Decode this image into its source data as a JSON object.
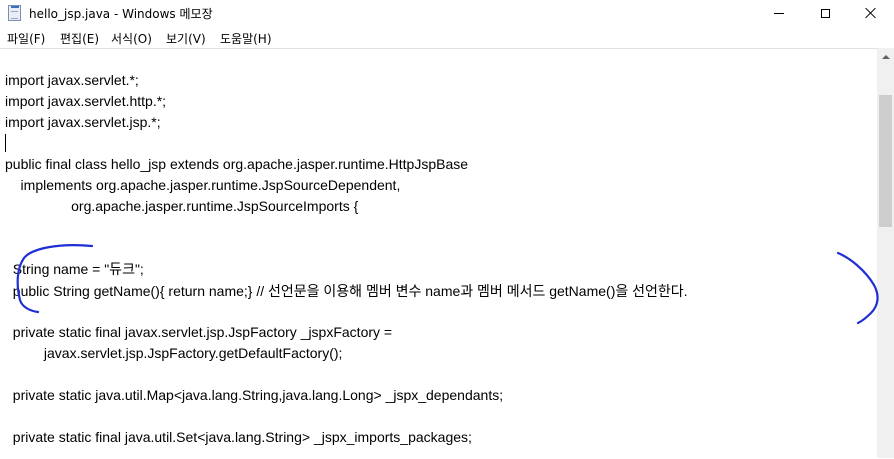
{
  "window": {
    "title": "hello_jsp.java - Windows 메모장",
    "icon": "notepad-icon",
    "controls": [
      "minimize-icon",
      "maximize-icon",
      "close-icon"
    ]
  },
  "menu": {
    "items": [
      "파일(F)",
      "편집(E)",
      "서식(O)",
      "보기(V)",
      "도움말(H)"
    ]
  },
  "editor": {
    "lines": [
      "import javax.servlet.*;",
      "import javax.servlet.http.*;",
      "import javax.servlet.jsp.*;",
      "",
      "public final class hello_jsp extends org.apache.jasper.runtime.HttpJspBase",
      "    implements org.apache.jasper.runtime.JspSourceDependent,",
      "                 org.apache.jasper.runtime.JspSourceImports {",
      "",
      "",
      "  String name = \"듀크\";",
      "  public String getName(){ return name;} // 선언문을 이용해 멤버 변수 name과 멤버 메서드 getName()을 선언한다.",
      "",
      "  private static final javax.servlet.jsp.JspFactory _jspxFactory =",
      "          javax.servlet.jsp.JspFactory.getDefaultFactory();",
      "",
      "  private static java.util.Map<java.lang.String,java.lang.Long> _jspx_dependants;",
      "",
      "  private static final java.util.Set<java.lang.String> _jspx_imports_packages;"
    ]
  },
  "annotation": {
    "color": "#1f2fd6"
  }
}
